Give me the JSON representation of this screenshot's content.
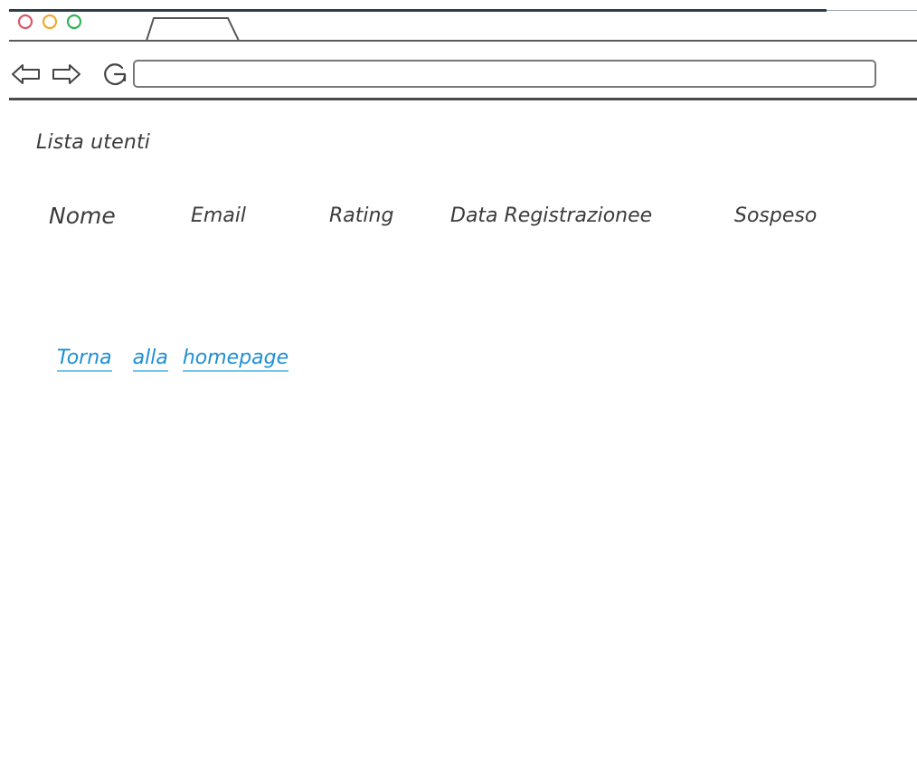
{
  "browser": {
    "window_controls": [
      {
        "name": "close",
        "color": "#d85a68"
      },
      {
        "name": "minimize",
        "color": "#efaa33"
      },
      {
        "name": "maximize",
        "color": "#2fb65a"
      }
    ],
    "icons": {
      "back": "back-arrow-icon",
      "forward": "forward-arrow-icon",
      "reload": "reload-icon"
    },
    "address_value": ""
  },
  "page": {
    "title": "Lista utenti",
    "table_headers": [
      "Nome",
      "Email",
      "Rating",
      "Data Registrazionee",
      "Sospeso"
    ],
    "homepage_link": {
      "words": [
        "Torna",
        "alla",
        "homepage"
      ],
      "color": "#1f8fd3"
    }
  }
}
